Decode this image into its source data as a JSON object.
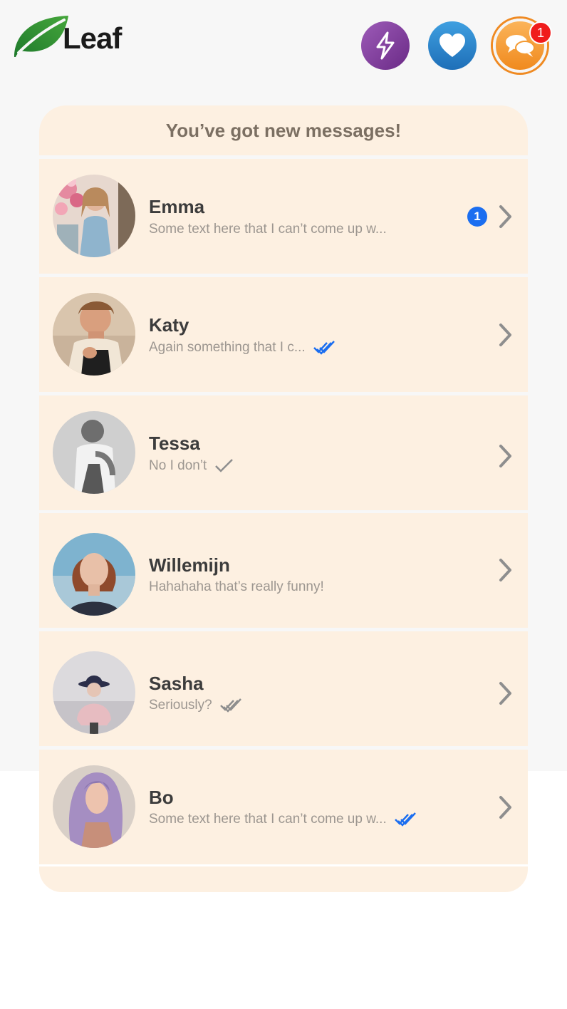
{
  "app": {
    "name": "Leaf"
  },
  "header": {
    "chat_badge": "1"
  },
  "card": {
    "title": "You’ve got new messages!"
  },
  "colors": {
    "read_blue": "#1b6ef0",
    "sent_grey": "#8e8e8e",
    "card_bg": "#fdf0e1"
  },
  "conversations": [
    {
      "name": "Emma",
      "preview": "Some text here that I can’t come up w...",
      "unread": "1",
      "status": "none"
    },
    {
      "name": "Katy",
      "preview": "Again something that I c...",
      "unread": "",
      "status": "read"
    },
    {
      "name": "Tessa",
      "preview": "No I don’t",
      "unread": "",
      "status": "sent"
    },
    {
      "name": "Willemijn",
      "preview": "Hahahaha that’s really funny!",
      "unread": "",
      "status": "none"
    },
    {
      "name": "Sasha",
      "preview": "Seriously?",
      "unread": "",
      "status": "delivered"
    },
    {
      "name": "Bo",
      "preview": "Some text here that I can’t come up w...",
      "unread": "",
      "status": "read"
    }
  ]
}
